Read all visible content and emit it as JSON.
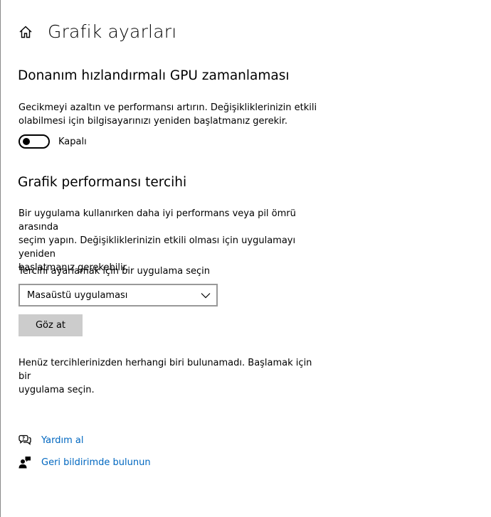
{
  "header": {
    "title": "Grafik ayarları",
    "home_icon": "home-icon"
  },
  "gpu_scheduling": {
    "title": "Donanım hızlandırmalı GPU zamanlaması",
    "description_line1": "Gecikmeyi azaltın ve performansı artırın. Değişikliklerinizin etkili",
    "description_line2": "olabilmesi için bilgisayarınızı yeniden başlatmanız gerekir.",
    "toggle_state": "off",
    "toggle_label": "Kapalı"
  },
  "graphics_preference": {
    "title": "Grafik performansı tercihi",
    "description_line1": "Bir uygulama kullanırken daha iyi performans veya pil ömrü arasında",
    "description_line2": "seçim yapın. Değişikliklerinizin etkili olması için uygulamayı yeniden",
    "description_line3": "başlatmanız gerekebilir.",
    "select_label": "Tercihi ayarlamak için bir uygulama seçin",
    "select_value": "Masaüstü uygulaması",
    "browse_button": "Göz at",
    "empty_line1": "Henüz tercihlerinizden herhangi biri bulunamadı. Başlamak için bir",
    "empty_line2": "uygulama seçin."
  },
  "links": {
    "help": "Yardım al",
    "help_icon": "help-chat-icon",
    "feedback": "Geri bildirimde bulunun",
    "feedback_icon": "feedback-person-icon"
  },
  "colors": {
    "link": "#0067c0",
    "button_bg": "#cccccc",
    "dropdown_border": "#999999"
  }
}
